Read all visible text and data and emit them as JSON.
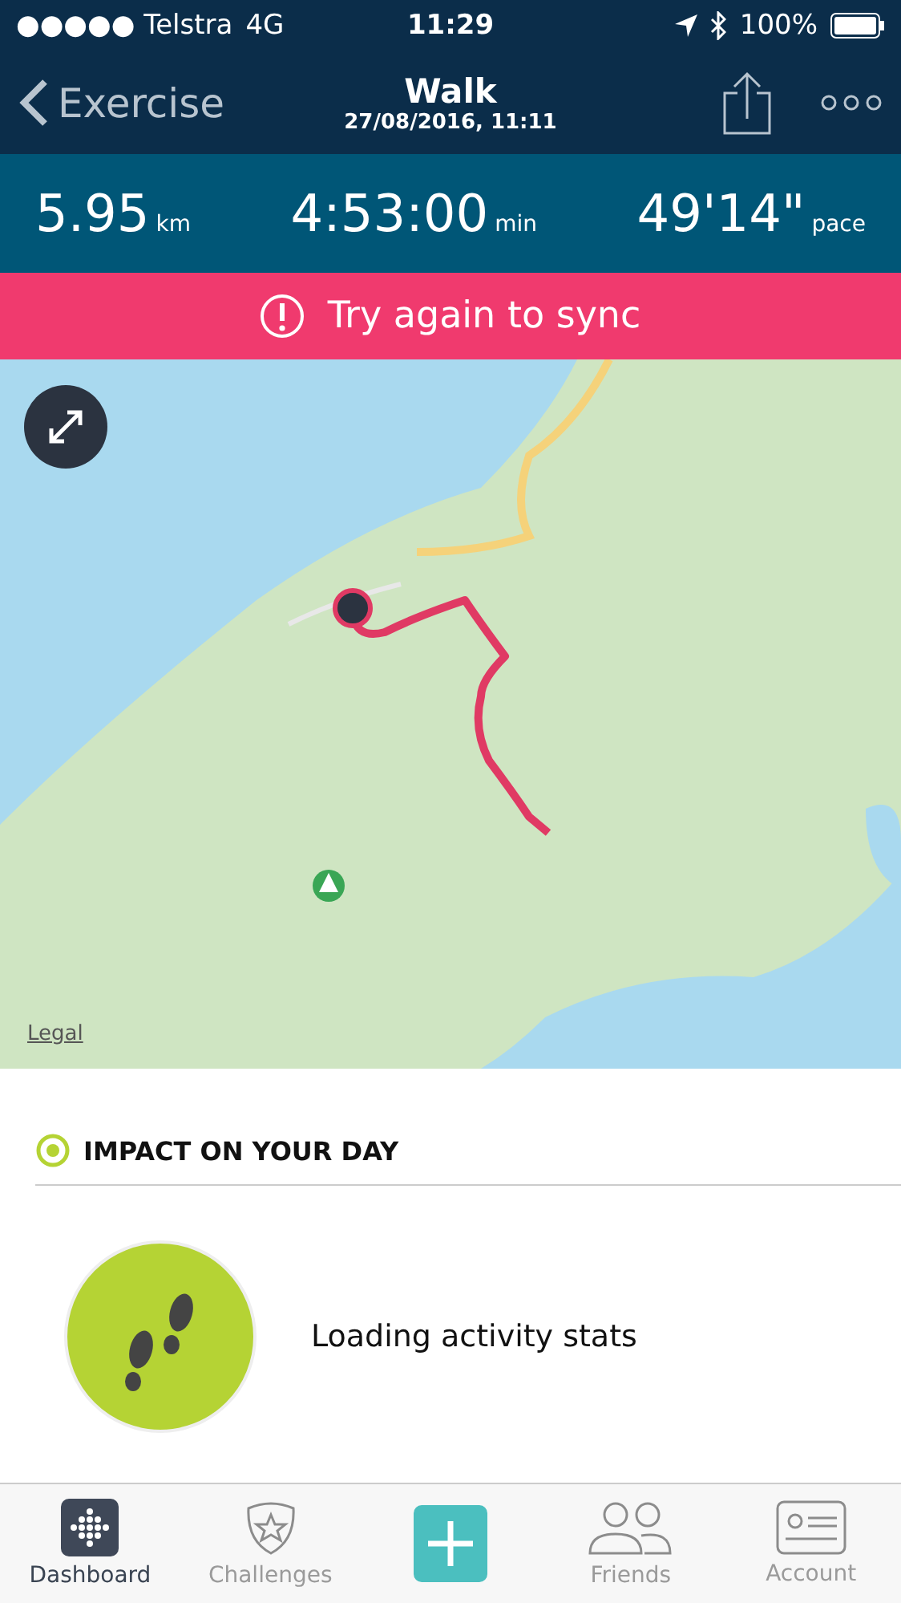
{
  "status_bar": {
    "carrier": "●●●●● Telstra",
    "network": "4G",
    "time": "11:29",
    "battery": "100%"
  },
  "nav": {
    "back": "Exercise",
    "title": "Walk",
    "subtitle": "27/08/2016, 11:11"
  },
  "stats": [
    {
      "value": "5.95",
      "unit": "km"
    },
    {
      "value": "4:53:00",
      "unit": "min"
    },
    {
      "value": "49'14\"",
      "unit": "pace"
    }
  ],
  "alert": {
    "text": "Try again to sync"
  },
  "map": {
    "kind": "picture",
    "legal": "Legal"
  },
  "section": {
    "title": "IMPACT ON YOUR DAY",
    "message": "Loading activity stats"
  },
  "tabs": [
    {
      "kind": "dashboard",
      "label": "Dashboard",
      "selected": true
    },
    {
      "kind": "challenges",
      "label": "Challenges",
      "selected": false
    },
    {
      "kind": "add",
      "selected": false
    },
    {
      "kind": "friends",
      "label": "Friends",
      "selected": false
    },
    {
      "kind": "account",
      "label": "Account",
      "selected": false
    }
  ]
}
